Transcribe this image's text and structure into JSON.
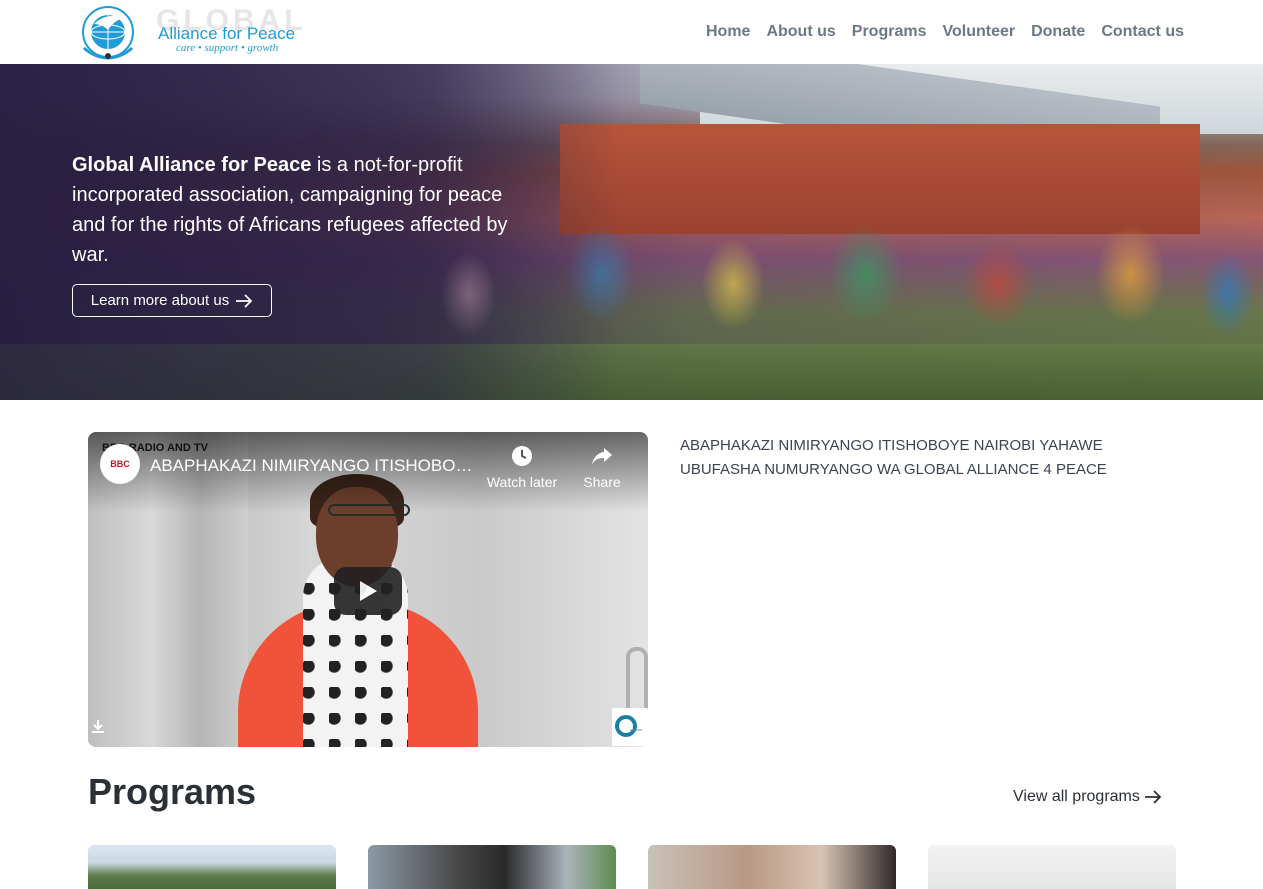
{
  "header": {
    "logo": {
      "watermark": "GLOBAL",
      "name": "Alliance for Peace",
      "tagline": "care • support • growth"
    },
    "nav": [
      {
        "label": "Home"
      },
      {
        "label": "About us"
      },
      {
        "label": "Programs"
      },
      {
        "label": "Volunteer"
      },
      {
        "label": "Donate"
      },
      {
        "label": "Contact us"
      }
    ]
  },
  "hero": {
    "org_name": "Global Alliance for Peace",
    "statement": " is a not-for-profit incorporated association, campaigning for peace and for the rights of Africans refugees affected by war.",
    "button_label": "Learn more about us"
  },
  "video": {
    "channel_overlay": "BBC RADIO AND TV",
    "channel_avatar": "BBC",
    "title": "ABAPHAKAZI NIMIRYANGO ITISHOBOYE NAIROBI YAHAWE UBUFASHA NUMURYANGO WA GLOBAL ALLIANCE 4 PEACE",
    "watch_later": "Watch later",
    "share": "Share",
    "description": "ABAPHAKAZI NIMIRYANGO ITISHOBOYE NAIROBI YAHAWE UBUFASHA NUMURYANGO WA GLOBAL ALLIANCE 4 PEACE"
  },
  "programs": {
    "heading": "Programs",
    "view_all": "View all programs"
  },
  "colors": {
    "brand_blue": "#1f9bd7",
    "nav_text": "#6c7888",
    "hero_overlay": "#261e40"
  },
  "icons": [
    "dove-globe-emblem",
    "arrow-right-icon",
    "clock-icon",
    "share-icon",
    "play-icon",
    "download-icon"
  ]
}
